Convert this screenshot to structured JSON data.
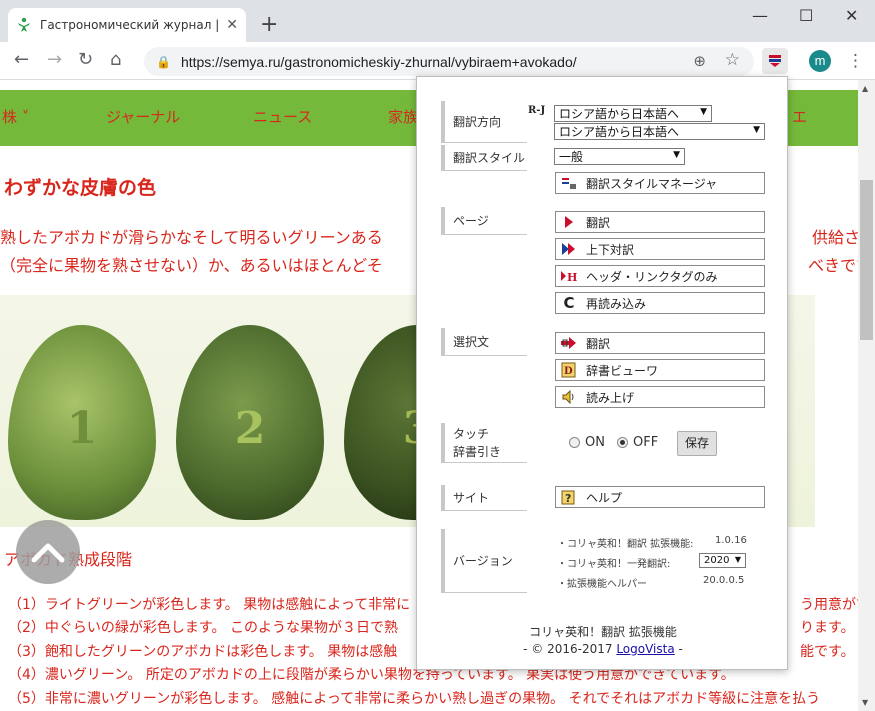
{
  "browser": {
    "tab_title": "Гастрономический журнал | Сем",
    "tab_close": "✕",
    "new_tab": "+",
    "win_min": "—",
    "win_max": "☐",
    "win_close": "✕",
    "back": "←",
    "forward": "→",
    "reload": "↻",
    "home": "⌂",
    "lock": "🔒",
    "url": "https://semya.ru/gastronomicheskiy-zhurnal/vybiraem+avokado/",
    "zoom": "⊕",
    "star": "☆",
    "avatar_letter": "m",
    "menu": "⋮"
  },
  "site_nav": {
    "item1": "株",
    "item2": "ジャーナル",
    "item3": "ニュース",
    "item4": "家族",
    "item5": "エ"
  },
  "article": {
    "heading": "わずかな皮膚の色",
    "intro_line1": "熟したアボカドが滑らかなそして明るいグリーンある",
    "intro_line1_right": "供給され",
    "intro_line2": "（完全に果物を熟させない）か、あるいはほとんどそ",
    "intro_line2_right": "べきです。",
    "avocado_numbers": [
      "1",
      "2",
      "3"
    ],
    "section_title": "アボカド熟成段階",
    "steps": [
      {
        "left": "（1）ライトグリーンが彩色します。 果物は感触によって非常に",
        "right": "う用意がで"
      },
      {
        "left": "（2）中ぐらいの緑が彩色します。 このような果物が３日で熟",
        "right": "ります。"
      },
      {
        "left": "（3）飽和したグリーンのアボカドは彩色します。 果物は感触",
        "right": "能です。"
      },
      {
        "left": "（4）濃いグリーン。 所定のアボカドの上に段階が柔らかい果物を持っています。 果実は使う用意ができています。",
        "right": ""
      },
      {
        "left": "（5）非常に濃いグリーンが彩色します。 感触によって非常に柔らかい熟し過ぎの果物。 それでそれはアボカド等級に注意を払う",
        "right": ""
      }
    ]
  },
  "popup": {
    "direction_label": "翻訳方向",
    "direction_badge": "R-J",
    "direction_value_top": "ロシア語から日本語へ",
    "direction_value": "ロシア語から日本語へ",
    "style_label": "翻訳スタイル",
    "style_value": "一般",
    "style_manager": "翻訳スタイルマネージャ",
    "page_label": "ページ",
    "page_translate": "翻訳",
    "page_parallel": "上下対訳",
    "page_header_link": "ヘッダ・リンクタグのみ",
    "page_reload": "再読み込み",
    "selection_label": "選択文",
    "sel_translate": "翻訳",
    "sel_dictionary": "辞書ビューワ",
    "sel_read": "読み上げ",
    "touch_label_1": "タッチ",
    "touch_label_2": "辞書引き",
    "radio_on": "ON",
    "radio_off": "OFF",
    "touch_selected": "OFF",
    "save": "保存",
    "site_label": "サイト",
    "help": "ヘルプ",
    "version_label": "バージョン",
    "versions": [
      {
        "name": "・コリャ英和！翻訳 拡張機能:",
        "value": "1.0.16"
      },
      {
        "name": "・コリャ英和！一発翻訳:",
        "value": "2020"
      },
      {
        "name": "・拡張機能ヘルパー",
        "value": "20.0.0.5"
      }
    ],
    "footer_title": "コリャ英和！翻訳 拡張機能",
    "footer_copy_prefix": "- © 2016-2017",
    "footer_link": "LogoVista",
    "footer_copy_suffix": "-"
  },
  "colors": {
    "nav_green": "#75b93b",
    "text_red": "#d9261c"
  }
}
